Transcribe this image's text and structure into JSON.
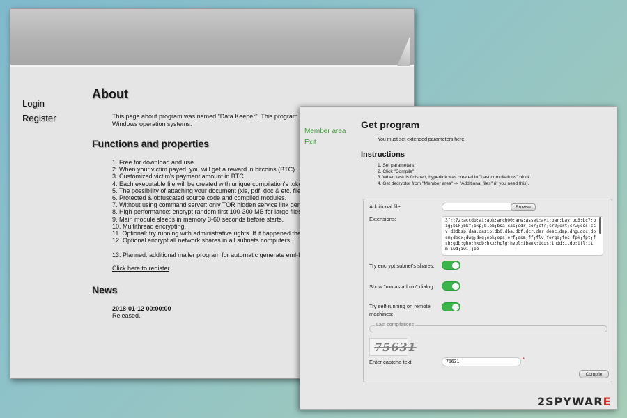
{
  "about_window": {
    "nav": [
      {
        "label": "Login"
      },
      {
        "label": "Register"
      }
    ],
    "title": "About",
    "intro_line1": "This page about program was named \"Data Keeper\". This program c",
    "intro_line2": "Windows operation systems.",
    "functions_heading": "Functions and properties",
    "functions": [
      "1. Free for download and use.",
      "2. When your victim payed, you will get a reward in bitcoins (BTC).",
      "3. Customized victim's payment amount in BTC.",
      "4. Each executable file will be created with unique compilation's token",
      "5. The possibility of attaching your document (xls, pdf, doc & etc. files) to",
      "6. Protected & obfuscated source code and compiled modules.",
      "7. Without using command server: only TOR hidden service link genera",
      "8. High performance: encrypt random first 100-300 MB for large files.",
      "9. Main module sleeps in memory 3-60 seconds before starts.",
      "10. Multithread encrypting.",
      "11. Optional: try running with administrative rights. If it happened then res",
      "12. Optional encrypt all network shares in all subnets computers."
    ],
    "planned": "13. Planned: additional mailer program for automatic generate eml-files f",
    "register_link": "Click here to register",
    "register_link_suffix": ".",
    "news_heading": "News",
    "news_date": "2018-01-12 00:00:00",
    "news_text": "Released."
  },
  "program_window": {
    "nav": [
      {
        "label": "Member area"
      },
      {
        "label": "Exit"
      }
    ],
    "title": "Get program",
    "subtitle": "You must set extended parameters here.",
    "instructions_heading": "Instructions",
    "instructions": [
      "1. Set parameters.",
      "2. Click \"Compile\".",
      "3. When task is finished, hyperlink was created in \"Last compilations\" block.",
      "4. Get decryptor from \"Member area\" -> \"Additional files\" (if you need this)."
    ],
    "form": {
      "additional_file_label": "Additional file:",
      "browse_label": "Browse",
      "extensions_label": "Extensions:",
      "extensions_value": "3fr;7z;accdb;ai;apk;arch00;arw;asset;avi;bar;bay;bc6;bc7;big;bik;bkf;bkp;blob;bsa;cas;cdr;cer;cfr;cr2;crt;crw;css;csv;d3dbsp;das;dazip;db0;dba;dbf;dcr;der;desc;dmp;dng;doc;docm;docx;dwg;dxg;epk;eps;erf;esm;ff;flv;forge;fos;fpk;fpt;fsh;gdb;gho;hkdb;hkx;hplg;hvpl;ibank;icxs;indd;itdb;itl;itm;iwd;iwi;jpe",
      "encrypt_subnet_label": "Try encrypt subnet's shares:",
      "encrypt_subnet_on": true,
      "run_as_admin_label": "Show \"run as admin\" dialog:",
      "run_as_admin_on": true,
      "self_running_label_1": "Try self-running on remote",
      "self_running_label_2": "machines:",
      "self_running_on": true,
      "last_compilations_label": "Last compilations",
      "captcha_image_text": "75631",
      "captcha_label": "Enter captcha text:",
      "captcha_value": "75631|",
      "required_mark": "*",
      "compile_label": "Compile"
    },
    "toggle_color": "#3ab54a",
    "nav_color": "#3a9c32"
  },
  "watermark": {
    "prefix": "2",
    "brand": "SPYWAR",
    "accent": "E"
  }
}
